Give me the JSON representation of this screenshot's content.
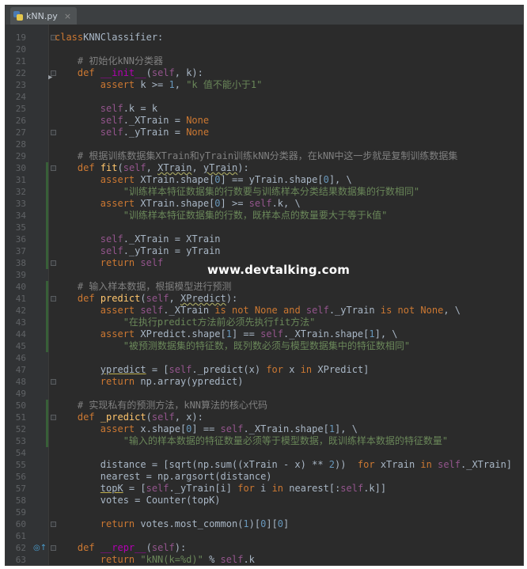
{
  "tab": {
    "icon": "python-file-icon",
    "label": "kNN.py",
    "close": "×"
  },
  "watermark": "www.devtalking.com",
  "lines": [
    {
      "n": "19",
      "t": [
        [
          "k",
          "class"
        ],
        [
          "",
          "KNNClassifier:"
        ]
      ]
    },
    {
      "n": "20",
      "t": []
    },
    {
      "n": "21",
      "t": [
        [
          "",
          "    "
        ],
        [
          "c",
          "# 初始化kNN分类器"
        ]
      ]
    },
    {
      "n": "22",
      "t": [
        [
          "",
          "    "
        ],
        [
          "k",
          "def "
        ],
        [
          "m",
          "__init__"
        ],
        [
          "",
          "("
        ],
        [
          "sf",
          "self"
        ],
        [
          "",
          ", k):"
        ]
      ]
    },
    {
      "n": "23",
      "t": [
        [
          "",
          "        "
        ],
        [
          "k",
          "assert "
        ],
        [
          "",
          "k >= "
        ],
        [
          "n",
          "1"
        ],
        [
          "",
          ", "
        ],
        [
          "s",
          "\"k 值不能小于1\""
        ]
      ]
    },
    {
      "n": "24",
      "t": []
    },
    {
      "n": "25",
      "t": [
        [
          "",
          "        "
        ],
        [
          "sf",
          "self"
        ],
        [
          "",
          ".k = k"
        ]
      ]
    },
    {
      "n": "26",
      "t": [
        [
          "",
          "        "
        ],
        [
          "sf",
          "self"
        ],
        [
          "",
          "._XTrain = "
        ],
        [
          "k",
          "None"
        ]
      ]
    },
    {
      "n": "27",
      "t": [
        [
          "",
          "        "
        ],
        [
          "sf",
          "self"
        ],
        [
          "",
          "._yTrain = "
        ],
        [
          "k",
          "None"
        ]
      ]
    },
    {
      "n": "28",
      "t": []
    },
    {
      "n": "29",
      "t": [
        [
          "",
          "    "
        ],
        [
          "c",
          "# 根据训练数据集XTrain和yTrain训练kNN分类器，在kNN中这一步就是复制训练数据集"
        ]
      ]
    },
    {
      "n": "30",
      "t": [
        [
          "",
          "    "
        ],
        [
          "k",
          "def "
        ],
        [
          "f",
          "fit"
        ],
        [
          "",
          "("
        ],
        [
          "sf",
          "self"
        ],
        [
          "",
          ", "
        ],
        [
          "wu",
          "XTrain"
        ],
        [
          "",
          ", "
        ],
        [
          "wu",
          "yTrain"
        ],
        [
          "",
          "):"
        ]
      ]
    },
    {
      "n": "31",
      "t": [
        [
          "",
          "        "
        ],
        [
          "k",
          "assert "
        ],
        [
          "",
          "XTrain.shape["
        ],
        [
          "n",
          "0"
        ],
        [
          "",
          "] == yTrain.shape["
        ],
        [
          "n",
          "0"
        ],
        [
          "",
          "], \\"
        ]
      ]
    },
    {
      "n": "32",
      "t": [
        [
          "",
          "            "
        ],
        [
          "s",
          "\"训练样本特征数据集的行数要与训练样本分类结果数据集的行数相同\""
        ]
      ]
    },
    {
      "n": "33",
      "t": [
        [
          "",
          "        "
        ],
        [
          "k",
          "assert "
        ],
        [
          "",
          "XTrain.shape["
        ],
        [
          "n",
          "0"
        ],
        [
          "",
          "] >= "
        ],
        [
          "sf",
          "self"
        ],
        [
          "",
          ".k, \\"
        ]
      ]
    },
    {
      "n": "34",
      "t": [
        [
          "",
          "            "
        ],
        [
          "s",
          "\"训练样本特征数据集的行数，既样本点的数量要大于等于k值\""
        ]
      ]
    },
    {
      "n": "35",
      "t": []
    },
    {
      "n": "36",
      "t": [
        [
          "",
          "        "
        ],
        [
          "sf",
          "self"
        ],
        [
          "",
          "._XTrain = XTrain"
        ]
      ]
    },
    {
      "n": "37",
      "t": [
        [
          "",
          "        "
        ],
        [
          "sf",
          "self"
        ],
        [
          "",
          "._yTrain = yTrain"
        ]
      ]
    },
    {
      "n": "38",
      "t": [
        [
          "",
          "        "
        ],
        [
          "k",
          "return "
        ],
        [
          "sf",
          "self"
        ]
      ]
    },
    {
      "n": "39",
      "t": []
    },
    {
      "n": "40",
      "t": [
        [
          "",
          "    "
        ],
        [
          "c",
          "# 输入样本数据，根据模型进行预测"
        ]
      ]
    },
    {
      "n": "41",
      "t": [
        [
          "",
          "    "
        ],
        [
          "k",
          "def "
        ],
        [
          "f",
          "predict"
        ],
        [
          "",
          "("
        ],
        [
          "sf",
          "self"
        ],
        [
          "",
          ", "
        ],
        [
          "wu",
          "XPredict"
        ],
        [
          "",
          "):"
        ]
      ]
    },
    {
      "n": "42",
      "t": [
        [
          "",
          "        "
        ],
        [
          "k",
          "assert "
        ],
        [
          "sf",
          "self"
        ],
        [
          "",
          "._XTrain "
        ],
        [
          "k",
          "is not None and "
        ],
        [
          "sf",
          "self"
        ],
        [
          "",
          "._yTrain "
        ],
        [
          "k",
          "is not "
        ],
        [
          "k",
          "None"
        ],
        [
          "",
          ", \\"
        ]
      ]
    },
    {
      "n": "43",
      "t": [
        [
          "",
          "            "
        ],
        [
          "s",
          "\"在执行predict方法前必须先执行fit方法\""
        ]
      ]
    },
    {
      "n": "44",
      "t": [
        [
          "",
          "        "
        ],
        [
          "k",
          "assert "
        ],
        [
          "",
          "XPredict.shape["
        ],
        [
          "n",
          "1"
        ],
        [
          "",
          "] == "
        ],
        [
          "sf",
          "self"
        ],
        [
          "",
          "._XTrain.shape["
        ],
        [
          "n",
          "1"
        ],
        [
          "",
          "], \\"
        ]
      ]
    },
    {
      "n": "45",
      "t": [
        [
          "",
          "            "
        ],
        [
          "s",
          "\"被预测数据集的特征数，既列数必须与模型数据集中的特征数相同\""
        ]
      ]
    },
    {
      "n": "46",
      "t": []
    },
    {
      "n": "47",
      "t": [
        [
          "",
          "        "
        ],
        [
          "u",
          "ypredict"
        ],
        [
          "",
          " = ["
        ],
        [
          "sf",
          "self"
        ],
        [
          "",
          "._predict(x) "
        ],
        [
          "k",
          "for "
        ],
        [
          "",
          "x "
        ],
        [
          "k",
          "in "
        ],
        [
          "",
          "XPredict]"
        ]
      ]
    },
    {
      "n": "48",
      "t": [
        [
          "",
          "        "
        ],
        [
          "k",
          "return "
        ],
        [
          "",
          "np.array(ypredict)"
        ]
      ]
    },
    {
      "n": "49",
      "t": []
    },
    {
      "n": "50",
      "t": [
        [
          "",
          "    "
        ],
        [
          "c",
          "# 实现私有的预测方法，kNN算法的核心代码"
        ]
      ]
    },
    {
      "n": "51",
      "t": [
        [
          "",
          "    "
        ],
        [
          "k",
          "def "
        ],
        [
          "f",
          "_predict"
        ],
        [
          "",
          "("
        ],
        [
          "sf",
          "self"
        ],
        [
          "",
          ", x):"
        ]
      ]
    },
    {
      "n": "52",
      "t": [
        [
          "",
          "        "
        ],
        [
          "k",
          "assert "
        ],
        [
          "",
          "x.shape["
        ],
        [
          "n",
          "0"
        ],
        [
          "",
          "] == "
        ],
        [
          "sf",
          "self"
        ],
        [
          "",
          "._XTrain.shape["
        ],
        [
          "n",
          "1"
        ],
        [
          "",
          "], \\"
        ]
      ]
    },
    {
      "n": "53",
      "t": [
        [
          "",
          "            "
        ],
        [
          "s",
          "\"输入的样本数据的特征数量必须等于模型数据，既训练样本数据的特征数量\""
        ]
      ]
    },
    {
      "n": "54",
      "t": []
    },
    {
      "n": "55",
      "t": [
        [
          "",
          "        "
        ],
        [
          "",
          "distance = [sqrt(np.sum((xTrain - x) ** "
        ],
        [
          "n",
          "2"
        ],
        [
          "",
          "))  "
        ],
        [
          "k",
          "for "
        ],
        [
          "",
          "xTrain "
        ],
        [
          "k",
          "in "
        ],
        [
          "sf",
          "self"
        ],
        [
          "",
          "._XTrain]"
        ]
      ]
    },
    {
      "n": "56",
      "t": [
        [
          "",
          "        "
        ],
        [
          "",
          "nearest = np.argsort(distance)"
        ]
      ]
    },
    {
      "n": "57",
      "t": [
        [
          "",
          "        "
        ],
        [
          "u",
          "topK"
        ],
        [
          "",
          "",
          " = ["
        ],
        [
          "sf",
          "self"
        ],
        [
          "",
          "._yTrain[i] "
        ],
        [
          "k",
          "for "
        ],
        [
          "",
          "i "
        ],
        [
          "k",
          "in "
        ],
        [
          "",
          "nearest[:"
        ],
        [
          "sf",
          "self"
        ],
        [
          "",
          ".k]]"
        ]
      ]
    },
    {
      "n": "58",
      "t": [
        [
          "",
          "        "
        ],
        [
          "",
          "votes = Counter(topK)"
        ]
      ]
    },
    {
      "n": "59",
      "t": []
    },
    {
      "n": "60",
      "t": [
        [
          "",
          "        "
        ],
        [
          "k",
          "return "
        ],
        [
          "",
          "votes.most_common("
        ],
        [
          "n",
          "1"
        ],
        [
          "",
          ")["
        ],
        [
          "n",
          "0"
        ],
        [
          "",
          "]["
        ],
        [
          "n",
          "0"
        ],
        [
          "",
          "]"
        ]
      ]
    },
    {
      "n": "61",
      "t": []
    },
    {
      "n": "62",
      "t": [
        [
          "",
          "    "
        ],
        [
          "k",
          "def "
        ],
        [
          "m",
          "__repr__"
        ],
        [
          "",
          "("
        ],
        [
          "sf",
          "self"
        ],
        [
          "",
          "):"
        ]
      ]
    },
    {
      "n": "63",
      "t": [
        [
          "",
          "        "
        ],
        [
          "k",
          "return "
        ],
        [
          "s",
          "\"kNN(k=%d)\""
        ],
        [
          "",
          " % "
        ],
        [
          "sf",
          "self"
        ],
        [
          "",
          ".k"
        ]
      ]
    }
  ],
  "gutter": {
    "changed_lines": [
      "30",
      "31",
      "32",
      "33",
      "34",
      "35",
      "36",
      "37",
      "38",
      "40",
      "41",
      "42",
      "43",
      "44",
      "45",
      "50",
      "51",
      "52",
      "53"
    ],
    "fold_lines": [
      "19",
      "22",
      "27",
      "30",
      "38",
      "41",
      "48",
      "51",
      "60",
      "62"
    ],
    "override_marker_line": "62",
    "override_icon": "override-method-icon",
    "breakpoint_arrow_line": "22"
  }
}
